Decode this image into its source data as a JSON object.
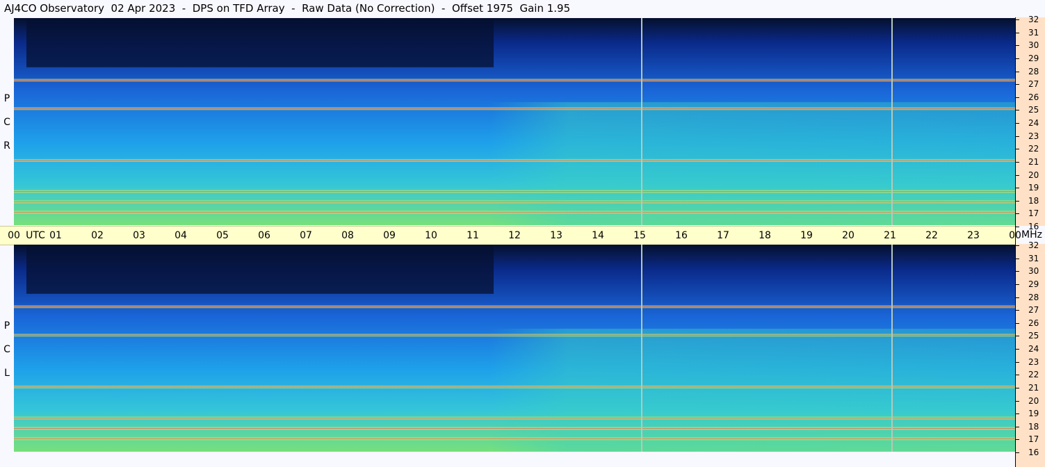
{
  "title": "AJ4CO Observatory  02 Apr 2023  -  DPS on TFD Array  -  Raw Data (No Correction)  -  Offset 1975  Gain 1.95",
  "panels": [
    {
      "id": "rcp",
      "label_letters": [
        "R",
        "C",
        "P"
      ]
    },
    {
      "id": "lcp",
      "label_letters": [
        "L",
        "C",
        "P"
      ]
    }
  ],
  "time_axis": {
    "ticks": [
      "00",
      "01",
      "02",
      "03",
      "04",
      "05",
      "06",
      "07",
      "08",
      "09",
      "10",
      "11",
      "12",
      "13",
      "14",
      "15",
      "16",
      "17",
      "18",
      "19",
      "20",
      "21",
      "22",
      "23",
      "00"
    ],
    "unit_label": "UTC"
  },
  "freq_axis": {
    "ticks": [
      "32",
      "31",
      "30",
      "29",
      "28",
      "27",
      "26",
      "25",
      "24",
      "23",
      "22",
      "21",
      "20",
      "19",
      "18",
      "17",
      "16"
    ],
    "unit_label": "MHz"
  },
  "colors": {
    "background": "#f8f8ff",
    "time_axis_bg": "#ffffcc",
    "freq_axis_bg": "#ffe1c7",
    "spectrogram_quiet": "#1a6fd6",
    "spectrogram_dark": "#061030",
    "spectrogram_strong": "#ffe840"
  },
  "chart_data": {
    "type": "heatmap",
    "title": "AJ4CO Observatory  02 Apr 2023  -  DPS on TFD Array  -  Raw Data (No Correction)  -  Offset 1975  Gain 1.95",
    "xlabel": "UTC",
    "ylabel": "MHz",
    "x_range": [
      0,
      24
    ],
    "y_range": [
      16,
      32
    ],
    "series": [
      {
        "name": "RCP",
        "approx_features": {
          "vertical_lines_utc": [
            15.05,
            21.05
          ],
          "dark_region_top_utc": [
            0.3,
            11.5
          ],
          "active_bands_mhz": [
            17.0,
            17.8,
            18.6,
            21.0,
            25.0,
            27.2
          ]
        }
      },
      {
        "name": "LCP",
        "approx_features": {
          "vertical_lines_utc": [
            15.05,
            21.05
          ],
          "dark_region_top_utc": [
            0.3,
            11.5
          ],
          "active_bands_mhz": [
            17.0,
            17.8,
            18.6,
            21.0,
            25.0,
            27.2
          ]
        }
      }
    ]
  }
}
